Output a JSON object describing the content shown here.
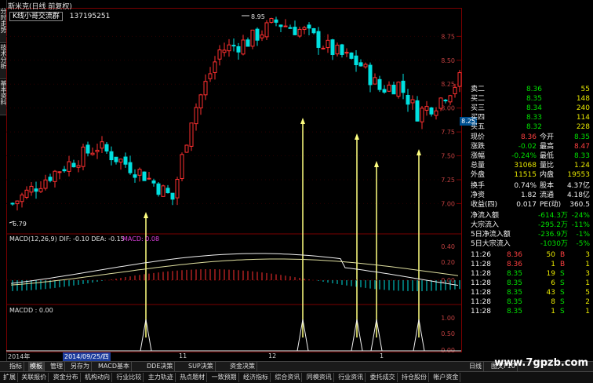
{
  "window": {
    "title": "斯米克(日线 前复权)",
    "formula_label": "K线小哥交流群",
    "formula_id": "137195251"
  },
  "left_tabs": [
    "分时走势",
    "技术分析",
    "基本资料"
  ],
  "main_chart": {
    "high_label": "8.95",
    "low_label": "6.79",
    "current_price_tag": "8.25",
    "y_ticks": [
      "8.75",
      "8.50",
      "8.25",
      "8.00",
      "7.75",
      "7.50",
      "7.25",
      "7.00"
    ],
    "colors": {
      "up": "#ff3030",
      "down": "#00e0e0",
      "grid": "#7a0000",
      "arrow": "#ffff80"
    }
  },
  "macd": {
    "header": "MACD(12,26,9) DIF: -0.10 DEA: -0.15",
    "macd_value": "MACD: 0.08",
    "y_ticks": [
      "0.40",
      "0.20",
      "0.00"
    ]
  },
  "macdd": {
    "header": "MACDD : 0.00",
    "y_ticks": [
      "1.00",
      "0.50",
      "0.00"
    ]
  },
  "date_axis": {
    "start": "2014年",
    "selected": "2014/09/25/四",
    "months": [
      "11",
      "12",
      "1"
    ]
  },
  "quote_panel": {
    "sells": [
      {
        "label": "卖二",
        "price": "8.36",
        "vol": "55"
      },
      {
        "label": "买二",
        "price": "8.35",
        "vol": "148"
      },
      {
        "label": "买三",
        "price": "8.34",
        "vol": "240"
      },
      {
        "label": "买四",
        "price": "8.33",
        "vol": "114"
      },
      {
        "label": "买五",
        "price": "8.32",
        "vol": "228"
      }
    ],
    "stats": [
      {
        "l1": "现价",
        "v1": "8.36",
        "l2": "今开",
        "v2": "8.35"
      },
      {
        "l1": "涨跌",
        "v1": "-0.02",
        "l2": "最高",
        "v2": "8.47"
      },
      {
        "l1": "涨幅",
        "v1": "-0.24%",
        "l2": "最低",
        "v2": "8.33"
      },
      {
        "l1": "总量",
        "v1": "31068",
        "l2": "量比",
        "v2": "1.24"
      },
      {
        "l1": "外盘",
        "v1": "11515",
        "l2": "内盘",
        "v2": "19553"
      }
    ],
    "stats2": [
      {
        "l1": "换手",
        "v1": "0.74%",
        "l2": "股本",
        "v2": "4.37亿"
      },
      {
        "l1": "净资",
        "v1": "1.82",
        "l2": "流通",
        "v2": "4.18亿"
      },
      {
        "l1": "收益(四)",
        "v1": "0.017",
        "l2": "PE(动)",
        "v2": "360.5"
      }
    ],
    "flows": [
      {
        "label": "净流入额",
        "val": "-614.3万",
        "pct": "-24%"
      },
      {
        "label": "大宗流入",
        "val": "-295.2万",
        "pct": "-11%"
      },
      {
        "label": "5日净流入额",
        "val": "-236.9万",
        "pct": "-1%"
      },
      {
        "label": "5日大宗流入",
        "val": "-1030万",
        "pct": "-5%"
      }
    ],
    "ticks": [
      {
        "t": "11:26",
        "p": "8.36",
        "v": "50",
        "s": "B",
        "n": "3"
      },
      {
        "t": "11:28",
        "p": "8.36",
        "v": "1",
        "s": "B",
        "n": "1"
      },
      {
        "t": "11:28",
        "p": "8.35",
        "v": "19",
        "s": "S",
        "n": "3"
      },
      {
        "t": "11:28",
        "p": "8.35",
        "v": "6",
        "s": "S",
        "n": "1"
      },
      {
        "t": "11:28",
        "p": "8.35",
        "v": "43",
        "s": "S",
        "n": "5"
      },
      {
        "t": "11:28",
        "p": "8.35",
        "v": "8",
        "s": "S",
        "n": "2"
      },
      {
        "t": "11:28",
        "p": "8.35",
        "v": "1",
        "s": "S",
        "n": "1"
      }
    ]
  },
  "tab_row1": [
    "指标",
    "模板",
    "管理",
    "另存为",
    "MACD基本",
    "DDE决策",
    "SUP决策",
    "资金决策"
  ],
  "tab_row1_right": [
    "日线",
    "图文F10"
  ],
  "tab_row2": [
    "扩展",
    "关联报价",
    "资金分布",
    "机构动向",
    "行业比较",
    "主力轨迹",
    "热点题材",
    "一致预期",
    "经济指标",
    "综合资讯",
    "同模资讯",
    "行业资讯",
    "委托成交",
    "持仓股份",
    "帐户资金"
  ],
  "watermark": "www.7gpzb.com"
}
